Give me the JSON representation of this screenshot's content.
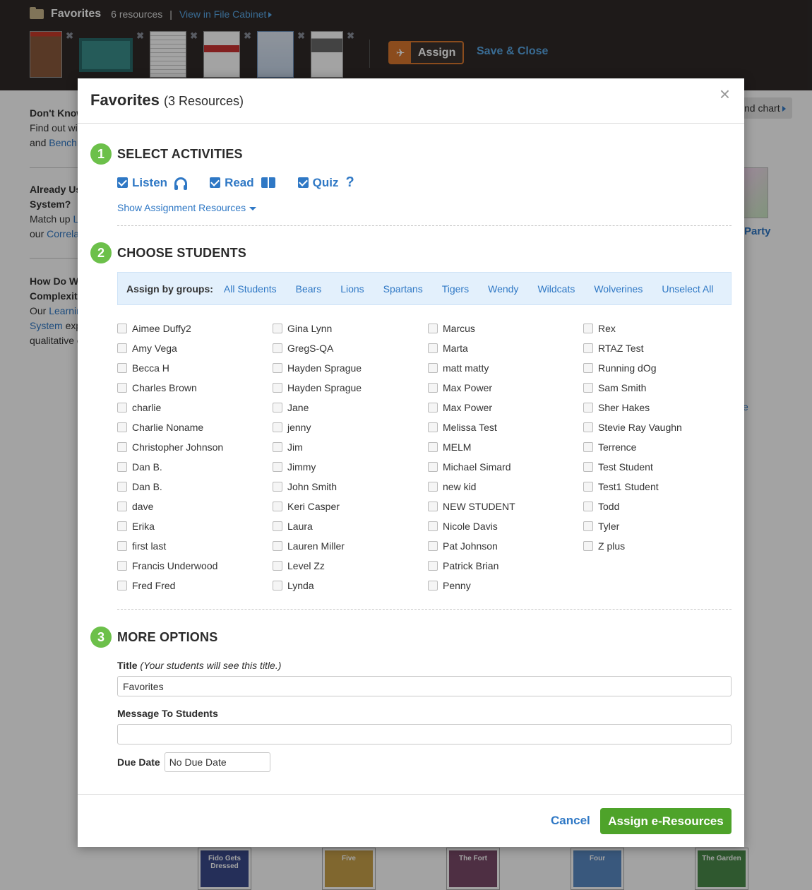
{
  "topbar": {
    "title": "Favorites",
    "count": "6 resources",
    "separator": "|",
    "cabinet_link": "View in File Cabinet",
    "remove_symbol": "✖",
    "assign_label": "Assign",
    "save_close": "Save & Close"
  },
  "background": {
    "dont_know_title": "Don't Know",
    "dont_know_l1": "Find out wit",
    "dont_know_l2_pre": "and",
    "dont_know_l2_link": "Benchm",
    "already_title_1": "Already Us",
    "already_title_2": "System?",
    "already_l1_pre": "Match up",
    "already_l1_link": "Le",
    "already_l2_pre": "our",
    "already_l2_link": "Correlat",
    "how_title_1": "How Do We",
    "how_title_2": "Complexity",
    "how_l1_pre": "Our",
    "how_l1_link": "Learnin",
    "how_l2_link": "System",
    "how_l2_post": "exp",
    "how_l3": "qualitative c",
    "chip": "nd chart",
    "party": "Party",
    "e_link": "e",
    "bottom_books": [
      "Fido Gets Dressed",
      "Five",
      "The Fort",
      "Four",
      "The Garden"
    ]
  },
  "modal": {
    "title": "Favorites",
    "count": "(3 Resources)",
    "close": "×",
    "step1": {
      "num": "1",
      "label": "SELECT ACTIVITIES"
    },
    "activities": [
      "Listen",
      "Read",
      "Quiz"
    ],
    "quiz_icon": "?",
    "show_resources": "Show Assignment Resources",
    "step2": {
      "num": "2",
      "label": "CHOOSE STUDENTS"
    },
    "groups_label": "Assign by groups:",
    "groups": [
      "All Students",
      "Bears",
      "Lions",
      "Spartans",
      "Tigers",
      "Wendy",
      "Wildcats",
      "Wolverines",
      "Unselect All"
    ],
    "students": [
      [
        "Aimee Duffy2",
        "Amy Vega",
        "Becca H",
        "Charles Brown",
        "charlie",
        "Charlie Noname",
        "Christopher Johnson",
        "Dan B.",
        "Dan B.",
        "dave",
        "Erika",
        "first last",
        "Francis Underwood",
        "Fred Fred"
      ],
      [
        "Gina Lynn",
        "GregS-QA",
        "Hayden Sprague",
        "Hayden Sprague",
        "Jane",
        "jenny",
        "Jim",
        "Jimmy",
        "John Smith",
        "Keri Casper",
        "Laura",
        "Lauren Miller",
        "Level Zz",
        "Lynda"
      ],
      [
        "Marcus",
        "Marta",
        "matt matty",
        "Max Power",
        "Max Power",
        "Melissa Test",
        "MELM",
        "Michael Simard",
        "new kid",
        "NEW STUDENT",
        "Nicole Davis",
        "Pat Johnson",
        "Patrick Brian",
        "Penny"
      ],
      [
        "Rex",
        "RTAZ Test",
        "Running dOg",
        "Sam Smith",
        "Sher Hakes",
        "Stevie Ray Vaughn",
        "Terrence",
        "Test Student",
        "Test1 Student",
        "Todd",
        "Tyler",
        "Z plus"
      ]
    ],
    "step3": {
      "num": "3",
      "label": "MORE OPTIONS"
    },
    "title_field_label": "Title",
    "title_field_hint": "(Your students will see this title.)",
    "title_value": "Favorites",
    "message_label": "Message To Students",
    "message_value": "",
    "due_label": "Due Date",
    "due_value": "No Due Date",
    "cancel": "Cancel",
    "assign": "Assign e-Resources"
  },
  "colors": {
    "accent": "#2f78c5",
    "step_green": "#6cc04a",
    "assign_green": "#4ea32a",
    "topbar": "#2f2a28",
    "assign_orange": "#d9782e"
  }
}
